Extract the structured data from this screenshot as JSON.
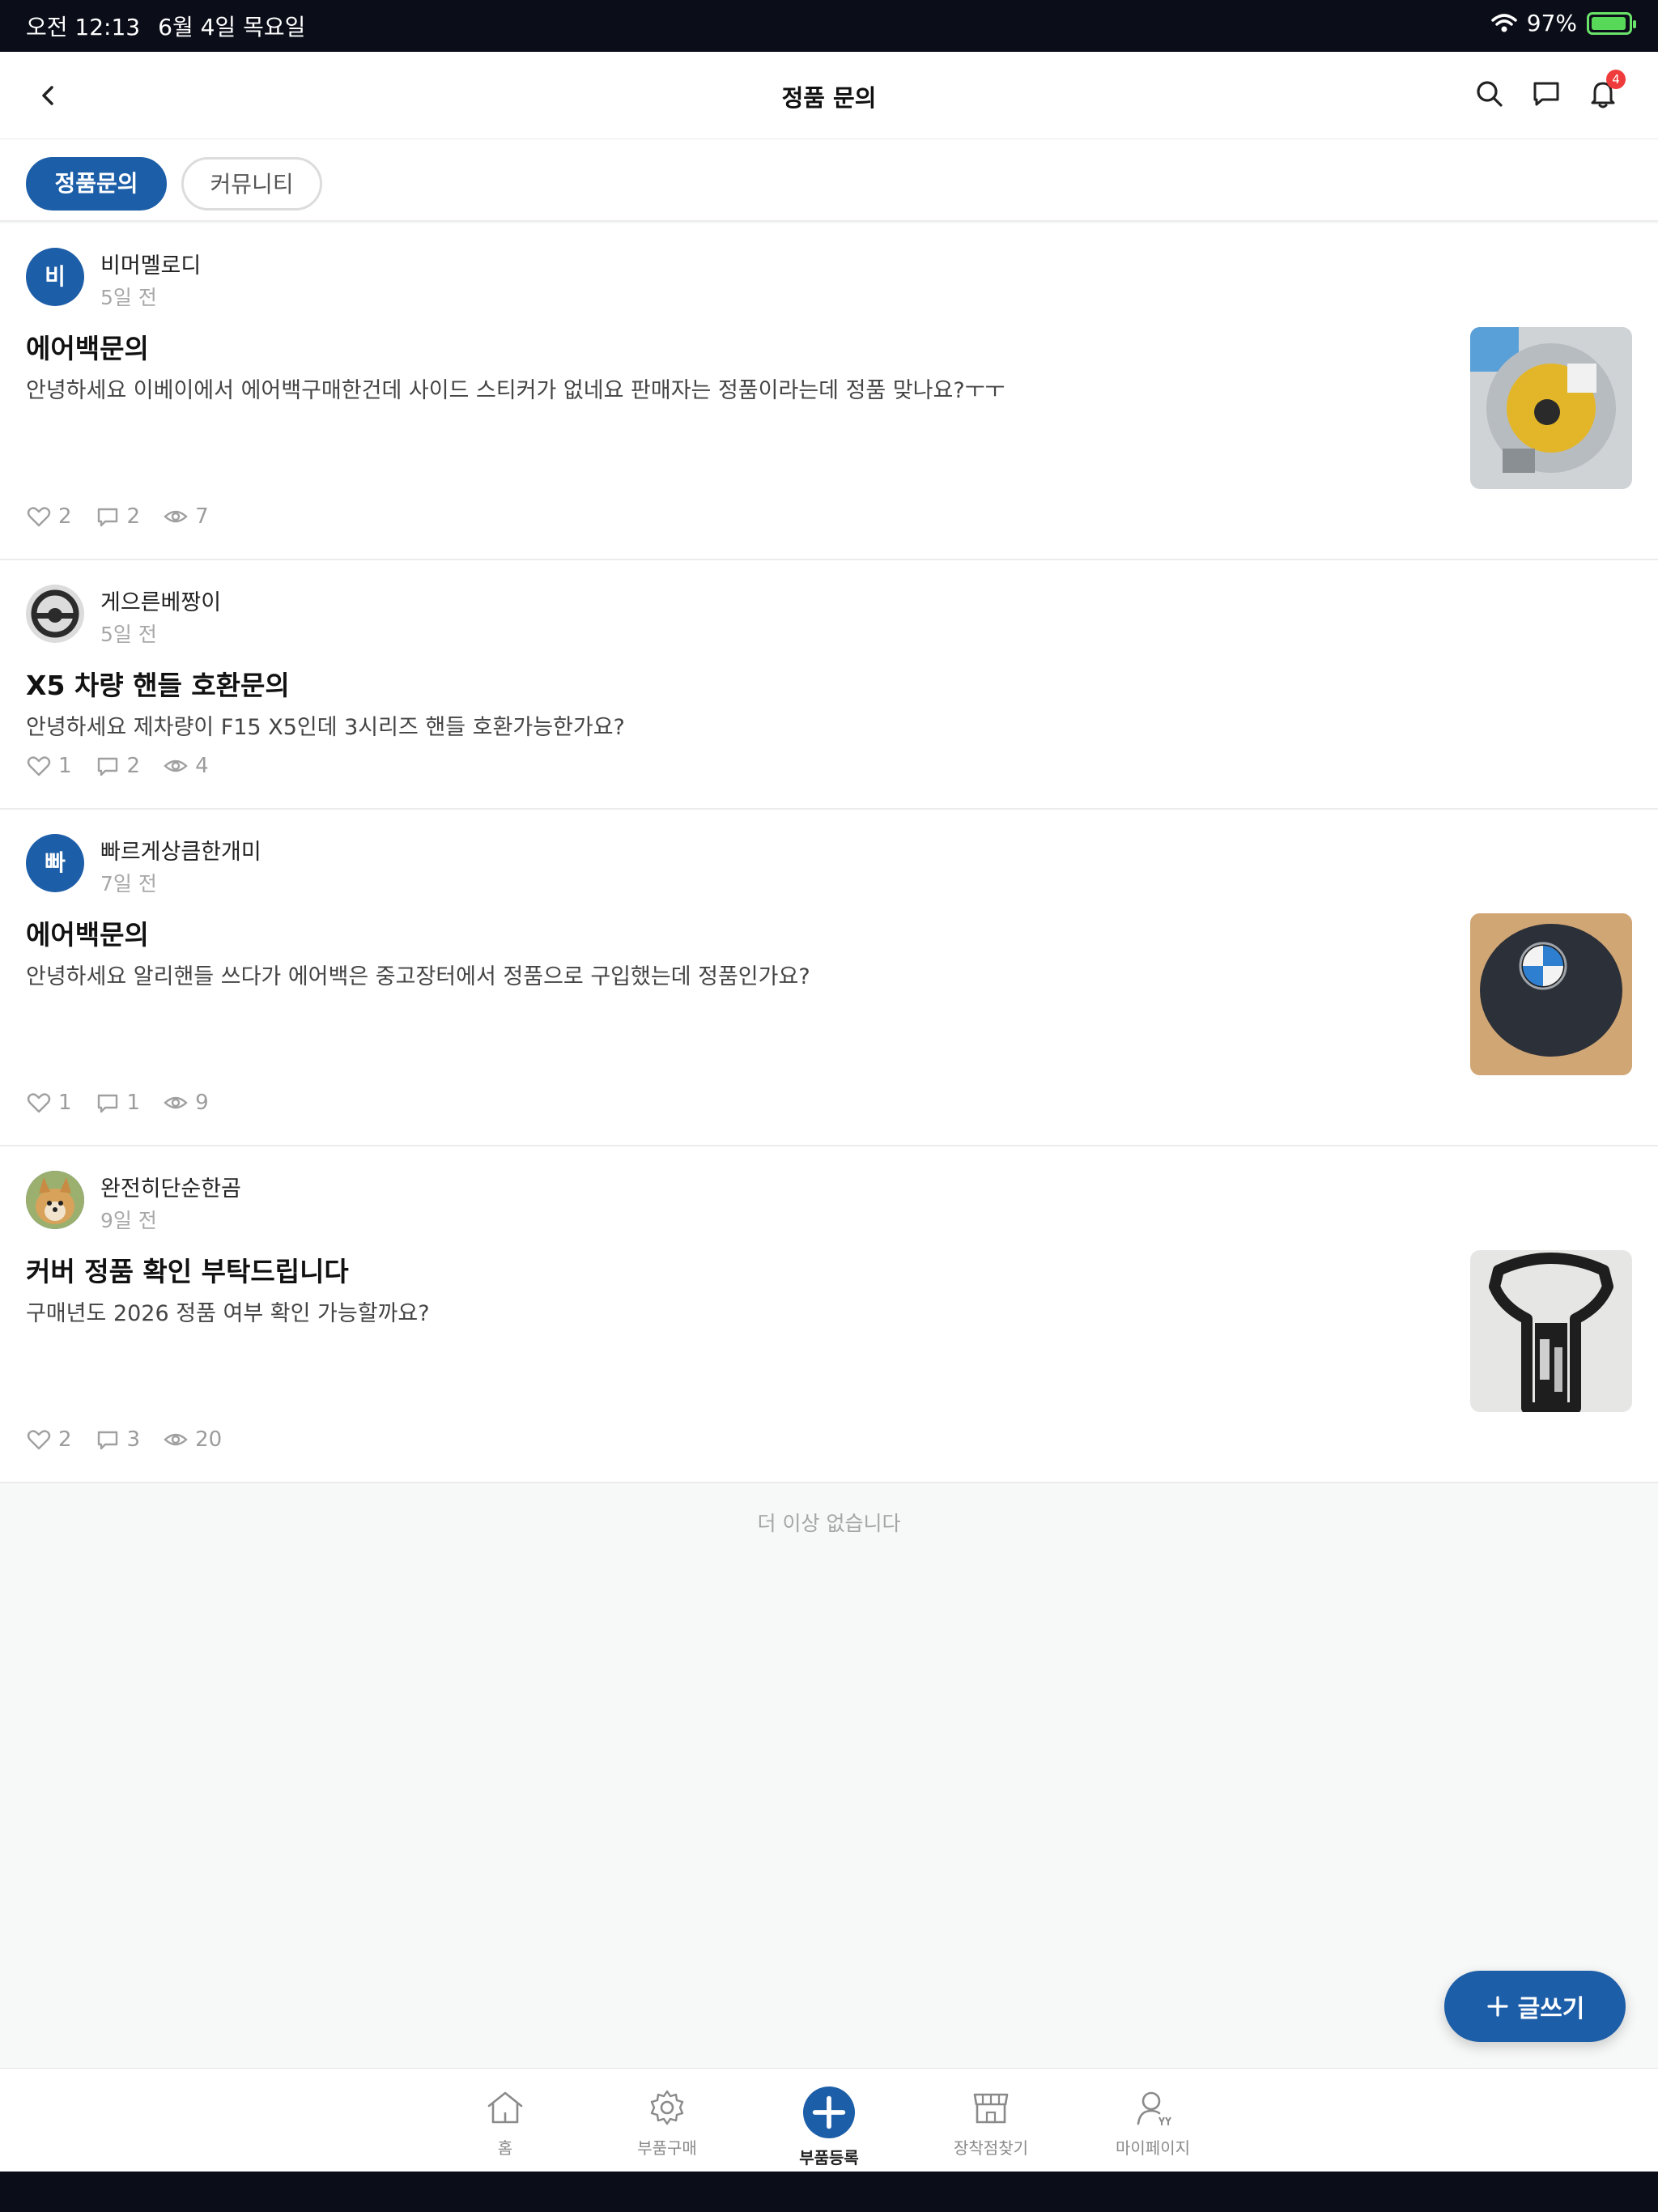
{
  "statusbar": {
    "time": "오전 12:13",
    "date": "6월 4일 목요일",
    "battery": "97%"
  },
  "header": {
    "title": "정품 문의",
    "notification_count": "4"
  },
  "tabs": [
    {
      "label": "정품문의"
    },
    {
      "label": "커뮤니티"
    }
  ],
  "posts": [
    {
      "avatar_text": "비",
      "author": "비머멜로디",
      "time": "5일 전",
      "title": "에어백문의",
      "body": "안녕하세요 이베이에서 에어백구매한건데 사이드 스티커가 없네요 판매자는 정품이라는데 정품 맞나요?ㅜㅜ",
      "likes": "2",
      "comments": "2",
      "views": "7"
    },
    {
      "avatar_text": "",
      "author": "게으른베짱이",
      "time": "5일 전",
      "title": "X5 차량 핸들 호환문의",
      "body": "안녕하세요 제차량이 F15 X5인데 3시리즈 핸들 호환가능한가요?",
      "likes": "1",
      "comments": "2",
      "views": "4"
    },
    {
      "avatar_text": "빠",
      "author": "빠르게상큼한개미",
      "time": "7일 전",
      "title": "에어백문의",
      "body": "안녕하세요 알리핸들 쓰다가 에어백은 중고장터에서 정품으로 구입했는데 정품인가요?",
      "likes": "1",
      "comments": "1",
      "views": "9"
    },
    {
      "avatar_text": "",
      "author": "완전히단순한곰",
      "time": "9일 전",
      "title": "커버 정품 확인 부탁드립니다",
      "body": "구매년도 2026 정품 여부 확인 가능할까요?",
      "likes": "2",
      "comments": "3",
      "views": "20"
    }
  ],
  "end_text": "더 이상 없습니다",
  "fab": {
    "label": "글쓰기"
  },
  "bottomnav": [
    {
      "label": "홈",
      "icon": "home-icon"
    },
    {
      "label": "부품구매",
      "icon": "gear-icon"
    },
    {
      "label": "부품등록",
      "icon": "plus-icon"
    },
    {
      "label": "장착점찾기",
      "icon": "store-icon"
    },
    {
      "label": "마이페이지",
      "icon": "profile-icon"
    }
  ],
  "colors": {
    "accent": "#1d5ea8",
    "badge": "#ef3b3b",
    "statusbar": "#0b0e19"
  }
}
